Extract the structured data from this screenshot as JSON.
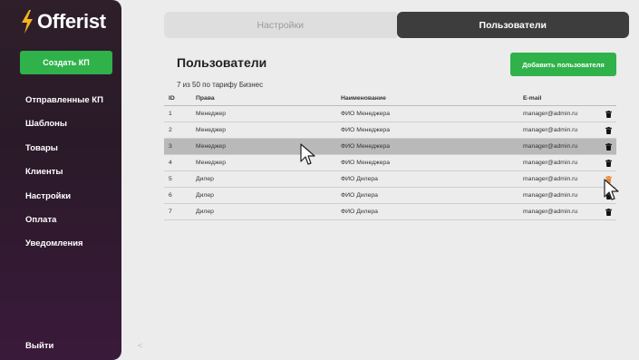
{
  "brand": {
    "name": "Offerist"
  },
  "sidebar": {
    "create_button": "Создать КП",
    "items": [
      {
        "label": "Отправленные КП"
      },
      {
        "label": "Шаблоны"
      },
      {
        "label": "Товары"
      },
      {
        "label": "Клиенты"
      },
      {
        "label": "Настройки"
      },
      {
        "label": "Оплата"
      },
      {
        "label": "Уведомления"
      }
    ],
    "logout": "Выйти",
    "collapse": "<"
  },
  "tabs": [
    {
      "label": "Настройки",
      "active": false
    },
    {
      "label": "Пользователи",
      "active": true
    }
  ],
  "main": {
    "title": "Пользователи",
    "add_button": "Добавить пользователя",
    "subtitle": "7 из 50 по тарифу Бизнес",
    "columns": [
      "ID",
      "Права",
      "Наименование",
      "E-mail"
    ],
    "rows": [
      {
        "id": "1",
        "role": "Менеджер",
        "name": "ФИО Менеджера",
        "email": "manager@admin.ru"
      },
      {
        "id": "2",
        "role": "Менеджер",
        "name": "ФИО Менеджера",
        "email": "manager@admin.ru"
      },
      {
        "id": "3",
        "role": "Менеджер",
        "name": "ФИО Менеджера",
        "email": "manager@admin.ru"
      },
      {
        "id": "4",
        "role": "Менеджер",
        "name": "ФИО Менеджера",
        "email": "manager@admin.ru"
      },
      {
        "id": "5",
        "role": "Дилер",
        "name": "ФИО Дилера",
        "email": "manager@admin.ru"
      },
      {
        "id": "6",
        "role": "Дилер",
        "name": "ФИО Дилера",
        "email": "manager@admin.ru"
      },
      {
        "id": "7",
        "role": "Дилер",
        "name": "ФИО Дилера",
        "email": "manager@admin.ru"
      }
    ],
    "row_action_icon": "trash-icon"
  },
  "colors": {
    "accent": "#2fb24a",
    "sidebar_bg": "#2e1f2a",
    "selected_row": "#b9b9b9",
    "delete_hover": "#e8883a",
    "logo_bolt": "#f5b41e"
  }
}
